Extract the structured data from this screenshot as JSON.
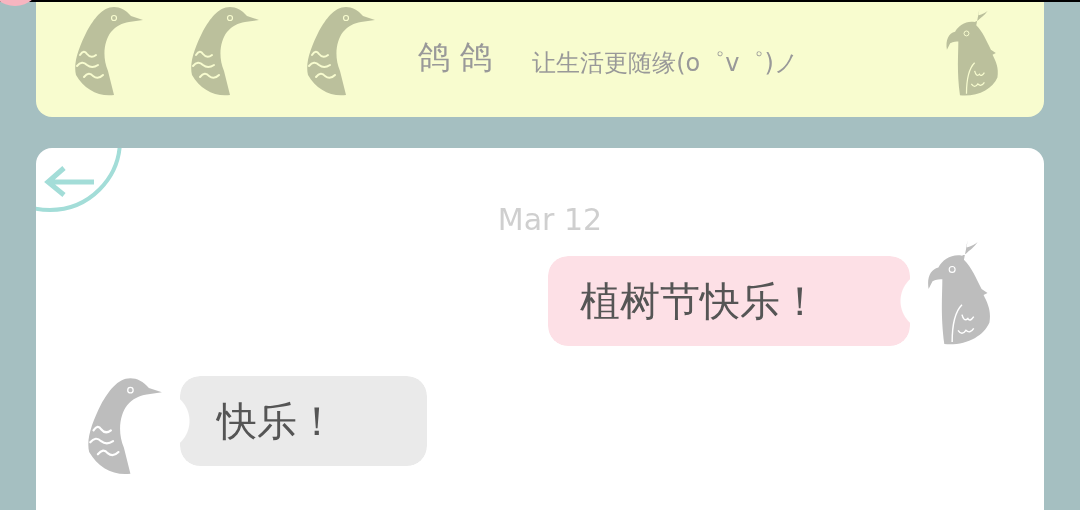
{
  "header": {
    "title": "鸽 鸽",
    "subtitle": "让生活更随缘(o゜v゜)ノ"
  },
  "chat": {
    "date": "Mar 12",
    "messages": [
      {
        "kind": "sent",
        "text": "植树节快乐！"
      },
      {
        "kind": "received",
        "text": "快乐！"
      }
    ]
  }
}
